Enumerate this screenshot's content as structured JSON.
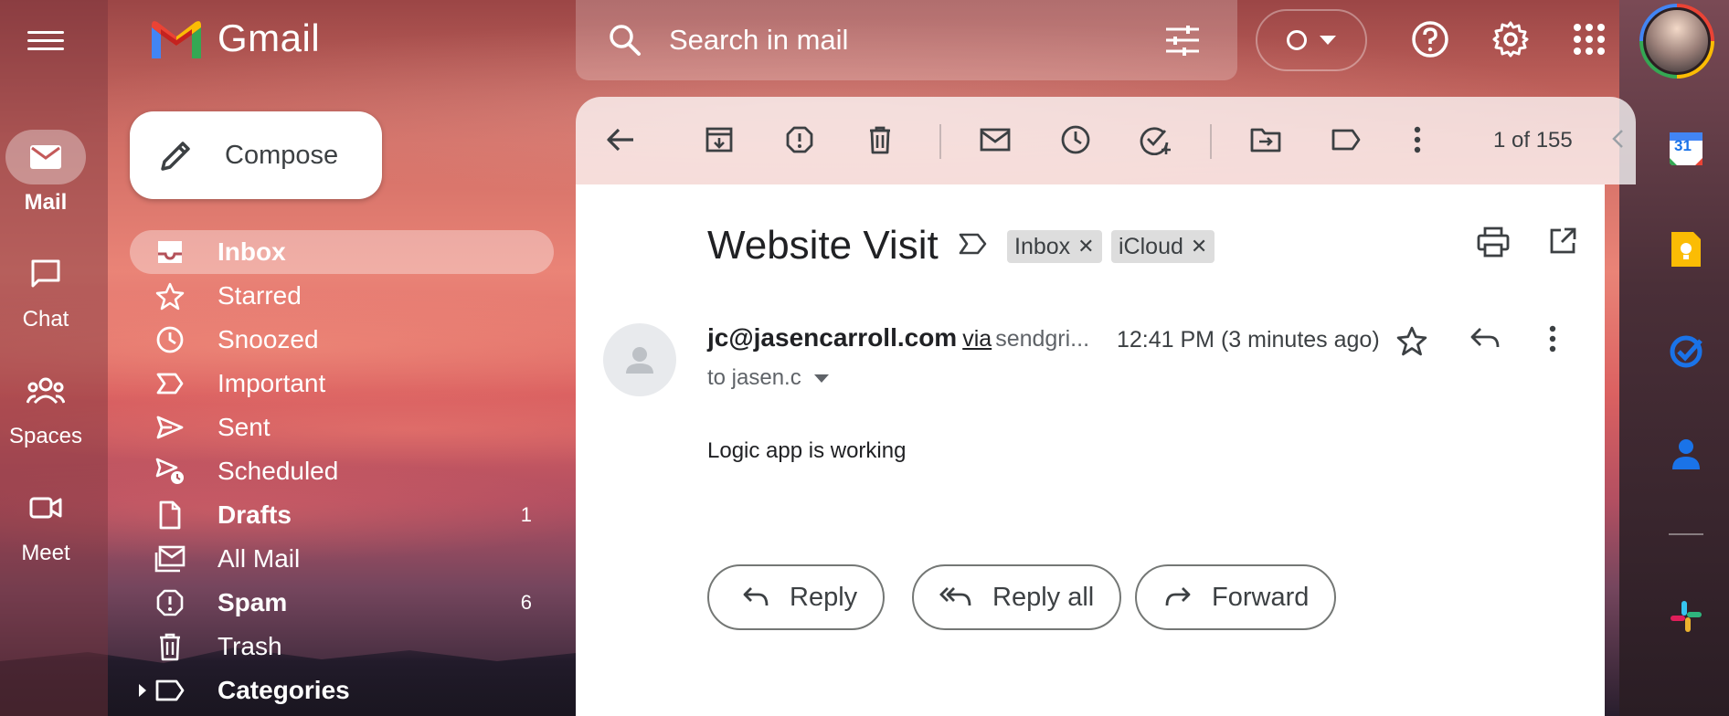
{
  "app": {
    "name": "Gmail"
  },
  "rail": {
    "items": [
      {
        "label": "Mail",
        "icon": "mail-icon",
        "active": true
      },
      {
        "label": "Chat",
        "icon": "chat-icon"
      },
      {
        "label": "Spaces",
        "icon": "spaces-icon"
      },
      {
        "label": "Meet",
        "icon": "meet-icon"
      }
    ]
  },
  "search": {
    "placeholder": "Search in mail"
  },
  "compose": {
    "label": "Compose"
  },
  "nav": {
    "items": [
      {
        "label": "Inbox",
        "icon": "inbox-icon",
        "bold": true,
        "active": true,
        "count": ""
      },
      {
        "label": "Starred",
        "icon": "star-icon",
        "count": ""
      },
      {
        "label": "Snoozed",
        "icon": "clock-icon",
        "count": ""
      },
      {
        "label": "Important",
        "icon": "important-icon",
        "count": ""
      },
      {
        "label": "Sent",
        "icon": "send-icon",
        "count": ""
      },
      {
        "label": "Scheduled",
        "icon": "scheduled-send-icon",
        "count": ""
      },
      {
        "label": "Drafts",
        "icon": "draft-icon",
        "bold": true,
        "count": "1"
      },
      {
        "label": "All Mail",
        "icon": "all-mail-icon",
        "count": ""
      },
      {
        "label": "Spam",
        "icon": "spam-icon",
        "bold": true,
        "count": "6"
      },
      {
        "label": "Trash",
        "icon": "trash-icon",
        "count": ""
      },
      {
        "label": "Categories",
        "icon": "label-icon",
        "bold": true,
        "count": ""
      }
    ]
  },
  "toolbar": {
    "pager": "1 of 155"
  },
  "message": {
    "subject": "Website Visit",
    "labels": [
      {
        "name": "Inbox"
      },
      {
        "name": "iCloud"
      }
    ],
    "sender_email": "jc@jasencarroll.com",
    "via_text": "via",
    "via_domain": "sendgri...",
    "time": "12:41 PM (3 minutes ago)",
    "to": "to jasen.c",
    "body": "Logic app is working"
  },
  "actions": {
    "reply": "Reply",
    "reply_all": "Reply all",
    "forward": "Forward"
  },
  "side_apps": {
    "calendar_day": "31"
  },
  "colors": {
    "google_blue": "#4285f4",
    "google_red": "#ea4335",
    "google_yellow": "#fbbc04",
    "google_green": "#34a853"
  }
}
